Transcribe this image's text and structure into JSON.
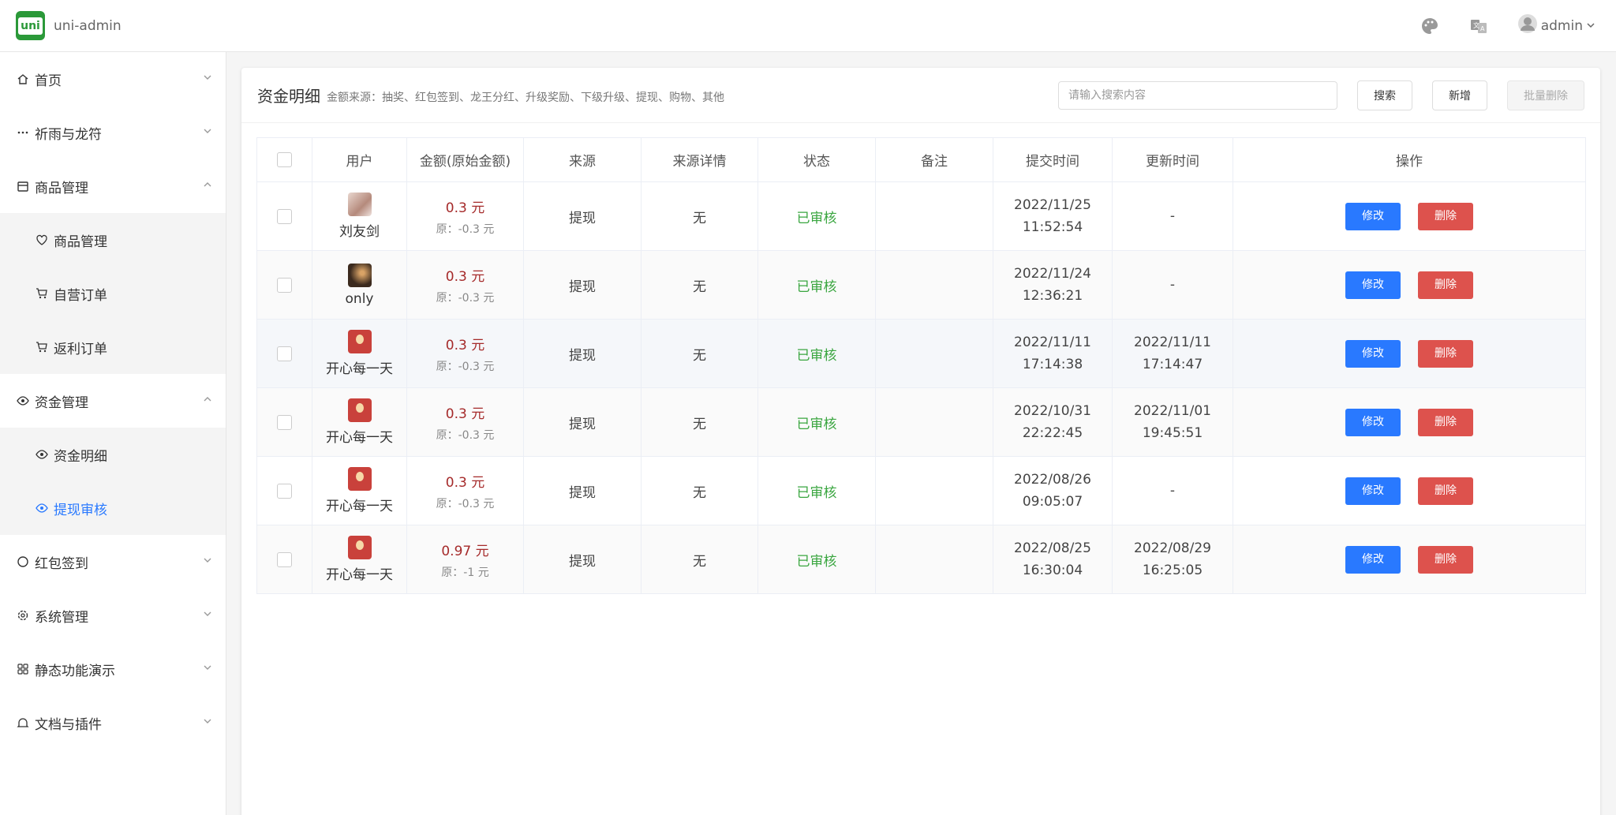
{
  "header": {
    "logo_text": "uni",
    "app_title": "uni-admin",
    "user_name": "admin",
    "icons": [
      "palette-icon",
      "translate-icon",
      "user-avatar-icon"
    ]
  },
  "sidebar": {
    "items": [
      {
        "label": "首页",
        "icon": "home-icon"
      },
      {
        "label": "祈雨与龙符",
        "icon": "more-icon"
      },
      {
        "label": "商品管理",
        "icon": "shop-icon",
        "expanded": true,
        "children": [
          {
            "label": "商品管理",
            "icon": "heart-icon"
          },
          {
            "label": "自营订单",
            "icon": "cart-icon"
          },
          {
            "label": "返利订单",
            "icon": "cart-icon"
          }
        ]
      },
      {
        "label": "资金管理",
        "icon": "eye-icon",
        "expanded": true,
        "children": [
          {
            "label": "资金明细",
            "icon": "eye-icon"
          },
          {
            "label": "提现审核",
            "icon": "eye-icon",
            "active": true
          }
        ]
      },
      {
        "label": "红包签到",
        "icon": "circle-icon"
      },
      {
        "label": "系统管理",
        "icon": "gear-icon"
      },
      {
        "label": "静态功能演示",
        "icon": "grid-icon"
      },
      {
        "label": "文档与插件",
        "icon": "bell-icon"
      }
    ]
  },
  "main": {
    "title": "资金明细",
    "subtitle": "金额来源：抽奖、红包签到、龙王分红、升级奖励、下级升级、提现、购物、其他",
    "search_placeholder": "请输入搜索内容",
    "search_button": "搜索",
    "add_button": "新增",
    "batch_delete_button": "批量删除",
    "columns": [
      "用户",
      "金额(原始金额)",
      "来源",
      "来源详情",
      "状态",
      "备注",
      "提交时间",
      "更新时间",
      "操作"
    ],
    "rows": [
      {
        "user": "刘友剑",
        "amount": "0.3 元",
        "original": "原：-0.3 元",
        "source": "提现",
        "detail": "无",
        "status": "已审核",
        "remark": "",
        "submit_date": "2022/11/25",
        "submit_time": "11:52:54",
        "update_date": "-",
        "update_time": "",
        "avatar_style": "av-1"
      },
      {
        "user": "only",
        "amount": "0.3 元",
        "original": "原：-0.3 元",
        "source": "提现",
        "detail": "无",
        "status": "已审核",
        "remark": "",
        "submit_date": "2022/11/24",
        "submit_time": "12:36:21",
        "update_date": "-",
        "update_time": "",
        "avatar_style": "av-2"
      },
      {
        "user": "开心每一天",
        "amount": "0.3 元",
        "original": "原：-0.3 元",
        "source": "提现",
        "detail": "无",
        "status": "已审核",
        "remark": "",
        "submit_date": "2022/11/11",
        "submit_time": "17:14:38",
        "update_date": "2022/11/11",
        "update_time": "17:14:47",
        "avatar_style": "av-3"
      },
      {
        "user": "开心每一天",
        "amount": "0.3 元",
        "original": "原：-0.3 元",
        "source": "提现",
        "detail": "无",
        "status": "已审核",
        "remark": "",
        "submit_date": "2022/10/31",
        "submit_time": "22:22:45",
        "update_date": "2022/11/01",
        "update_time": "19:45:51",
        "avatar_style": "av-3"
      },
      {
        "user": "开心每一天",
        "amount": "0.3 元",
        "original": "原：-0.3 元",
        "source": "提现",
        "detail": "无",
        "status": "已审核",
        "remark": "",
        "submit_date": "2022/08/26",
        "submit_time": "09:05:07",
        "update_date": "-",
        "update_time": "",
        "avatar_style": "av-3"
      },
      {
        "user": "开心每一天",
        "amount": "0.97 元",
        "original": "原：-1 元",
        "source": "提现",
        "detail": "无",
        "status": "已审核",
        "remark": "",
        "submit_date": "2022/08/25",
        "submit_time": "16:30:04",
        "update_date": "2022/08/29",
        "update_time": "16:25:05",
        "avatar_style": "av-3"
      }
    ],
    "edit_label": "修改",
    "delete_label": "删除"
  },
  "colors": {
    "accent": "#2979ff",
    "danger": "#dd524d",
    "success": "#3aa640",
    "amount": "#a52a2a",
    "logo": "#2b9939"
  }
}
